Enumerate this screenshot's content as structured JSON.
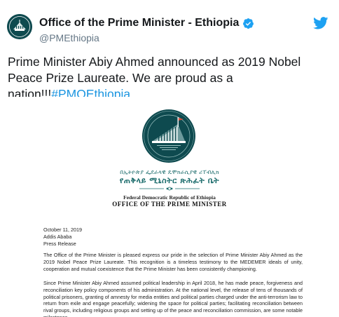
{
  "tweet": {
    "display_name": "Office of the Prime Minister - Ethiopia",
    "handle": "@PMEthiopia",
    "text": "Prime Minister Abiy Ahmed announced as 2019 Nobel Peace Prize Laureate. We are proud as a nation!!!",
    "hashtag": "#PMOEthiopia",
    "icons": {
      "avatar": "pmo-seal-avatar",
      "verified": "verified-badge-icon",
      "platform": "twitter-bird-icon"
    },
    "colors": {
      "link": "#1b95e0",
      "verified": "#1da1f2",
      "seal": "#0e4a4f"
    }
  },
  "document": {
    "seal_text": "Federal Democratic Republic of Ethiopia Office of the Prime Minister",
    "amharic_line1": "በኢትዮጵያ ፌደራላዊ ዴሞክራሲያዊ ሪፐብሊክ",
    "amharic_line2": "የጠቅላይ ሚኒስትር ጽሕፈት ቤት",
    "fdre": "Federal Democratic Republic of Ethiopia",
    "office": "OFFICE OF THE PRIME MINISTER",
    "date": "October 11, 2019",
    "place": "Addis Ababa",
    "type": "Press Release",
    "paragraph1": "The Office of the Prime Minister is pleased express our pride in the selection of Prime Minister Abiy Ahmed as the 2019 Nobel Peace Prize Laureate. This recognition is a timeless testimony to the MEDEMER ideals of unity, cooperation and mutual coexistence that the Prime Minister has been consistently championing.",
    "paragraph2": "Since Prime Minister Abiy Ahmed assumed political leadership in April 2018, he has made peace, forgiveness and reconciliation key policy components of his administration. At the national level, the release of tens of thousands of political prisoners, granting of amnesty for media entities and political parties charged under the anti-terrorism law to return from exile and engage peacefully; widening the space for political parties; facilitating reconciliation between rival groups, including religious groups and setting up of the peace and reconciliation commission, are some notable milestones."
  }
}
